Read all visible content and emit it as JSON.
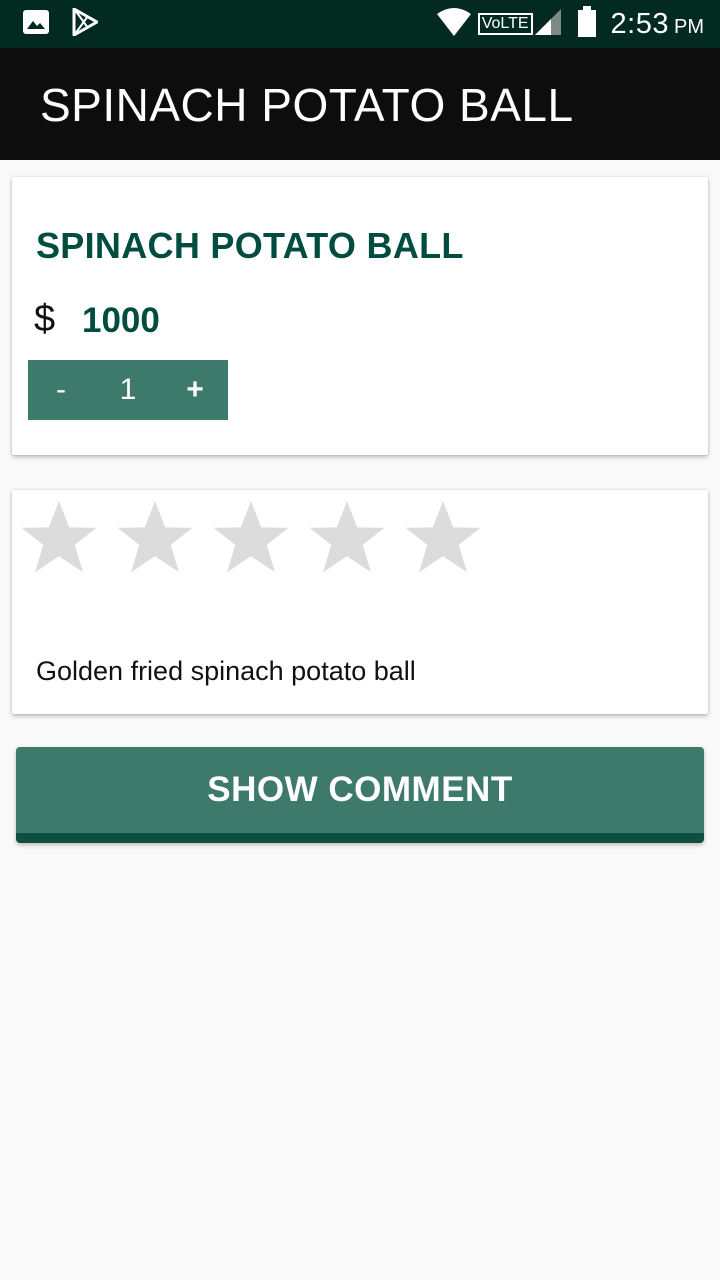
{
  "status_bar": {
    "icons": [
      "image-icon",
      "play-store-icon",
      "wifi-icon",
      "volte-icon",
      "signal-icon",
      "battery-icon"
    ],
    "volte_label": "VoLTE",
    "time": "2:53",
    "ampm": "PM"
  },
  "app_bar": {
    "title": "SPINACH POTATO BALL"
  },
  "product": {
    "name": "SPINACH POTATO BALL",
    "currency_symbol": "$",
    "price": "1000",
    "stepper": {
      "minus_label": "-",
      "quantity": "1",
      "plus_label": "+"
    }
  },
  "rating": {
    "rating_value": 0,
    "max_stars": 5,
    "star_color_empty": "#dcdcdc"
  },
  "description": "Golden fried spinach potato ball",
  "show_comment_label": "SHOW COMMENT",
  "colors": {
    "status_bar": "#022a20",
    "app_bar": "#0d0d0d",
    "accent": "#3d7a6c",
    "accent_dark": "#0f4f3f",
    "title_text": "#004d40"
  }
}
